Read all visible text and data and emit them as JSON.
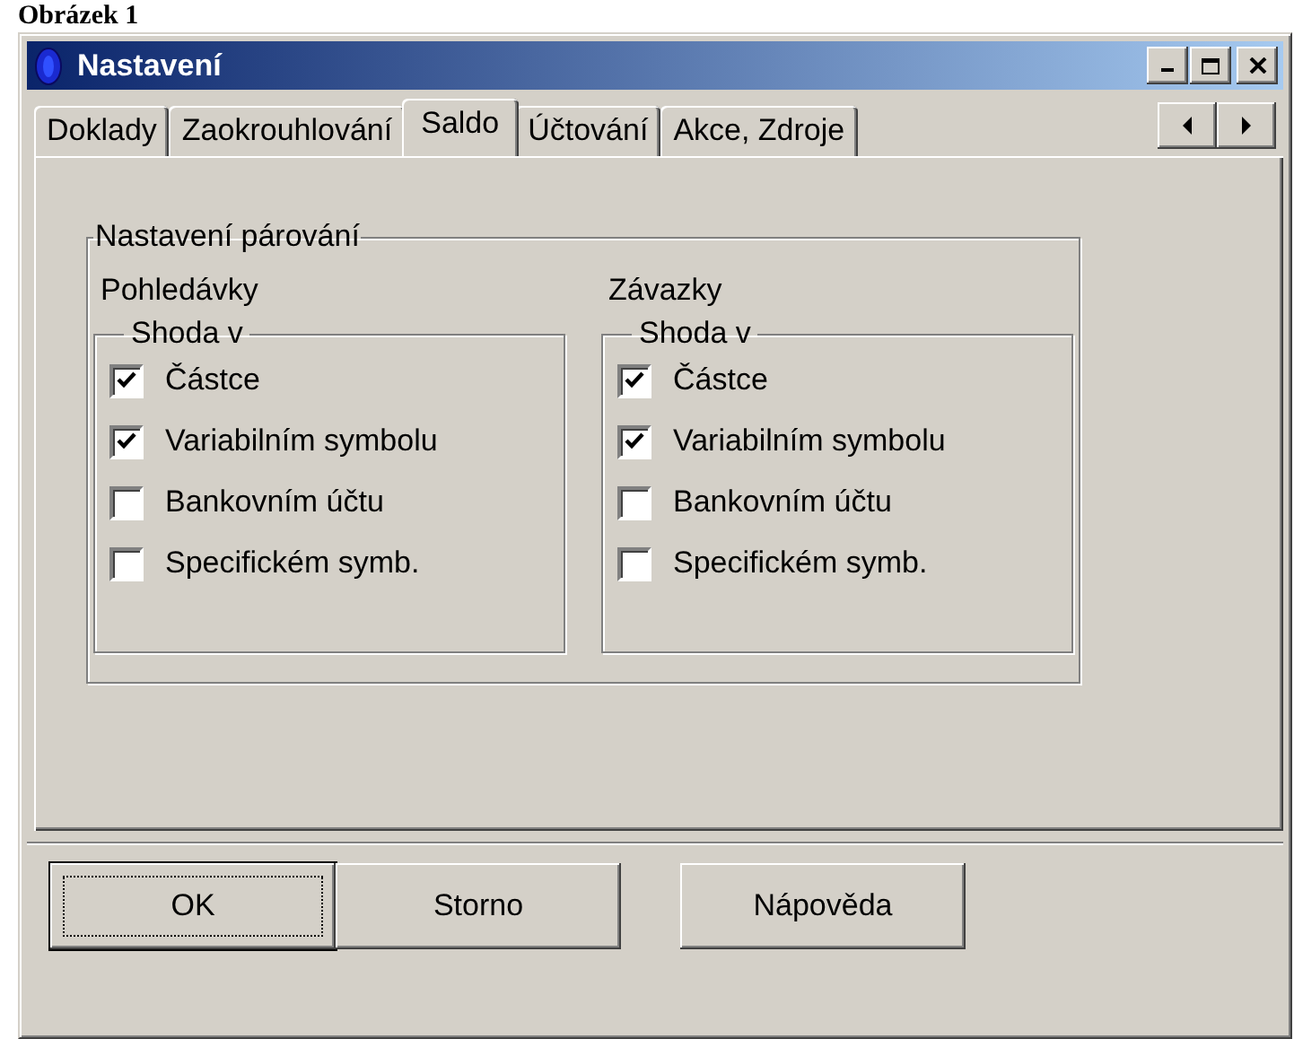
{
  "caption": "Obrázek 1",
  "window": {
    "title": "Nastavení"
  },
  "tabs": [
    {
      "label": "Doklady",
      "selected": false
    },
    {
      "label": "Zaokrouhlování",
      "selected": false
    },
    {
      "label": "Saldo",
      "selected": true
    },
    {
      "label": "Účtování",
      "selected": false
    },
    {
      "label": "Akce, Zdroje",
      "selected": false
    }
  ],
  "pairing": {
    "title": "Nastavení párování",
    "columns": [
      {
        "heading": "Pohledávky",
        "group_title": "Shoda v",
        "options": [
          {
            "label": "Částce",
            "checked": true
          },
          {
            "label": "Variabilním symbolu",
            "checked": true
          },
          {
            "label": "Bankovním účtu",
            "checked": false
          },
          {
            "label": "Specifickém symb.",
            "checked": false
          }
        ]
      },
      {
        "heading": "Závazky",
        "group_title": "Shoda v",
        "options": [
          {
            "label": "Částce",
            "checked": true
          },
          {
            "label": "Variabilním symbolu",
            "checked": true
          },
          {
            "label": "Bankovním účtu",
            "checked": false
          },
          {
            "label": "Specifickém symb.",
            "checked": false
          }
        ]
      }
    ]
  },
  "buttons": [
    {
      "label": "OK",
      "default": true
    },
    {
      "label": "Storno",
      "default": false
    },
    {
      "label": "Nápověda",
      "default": false
    }
  ]
}
